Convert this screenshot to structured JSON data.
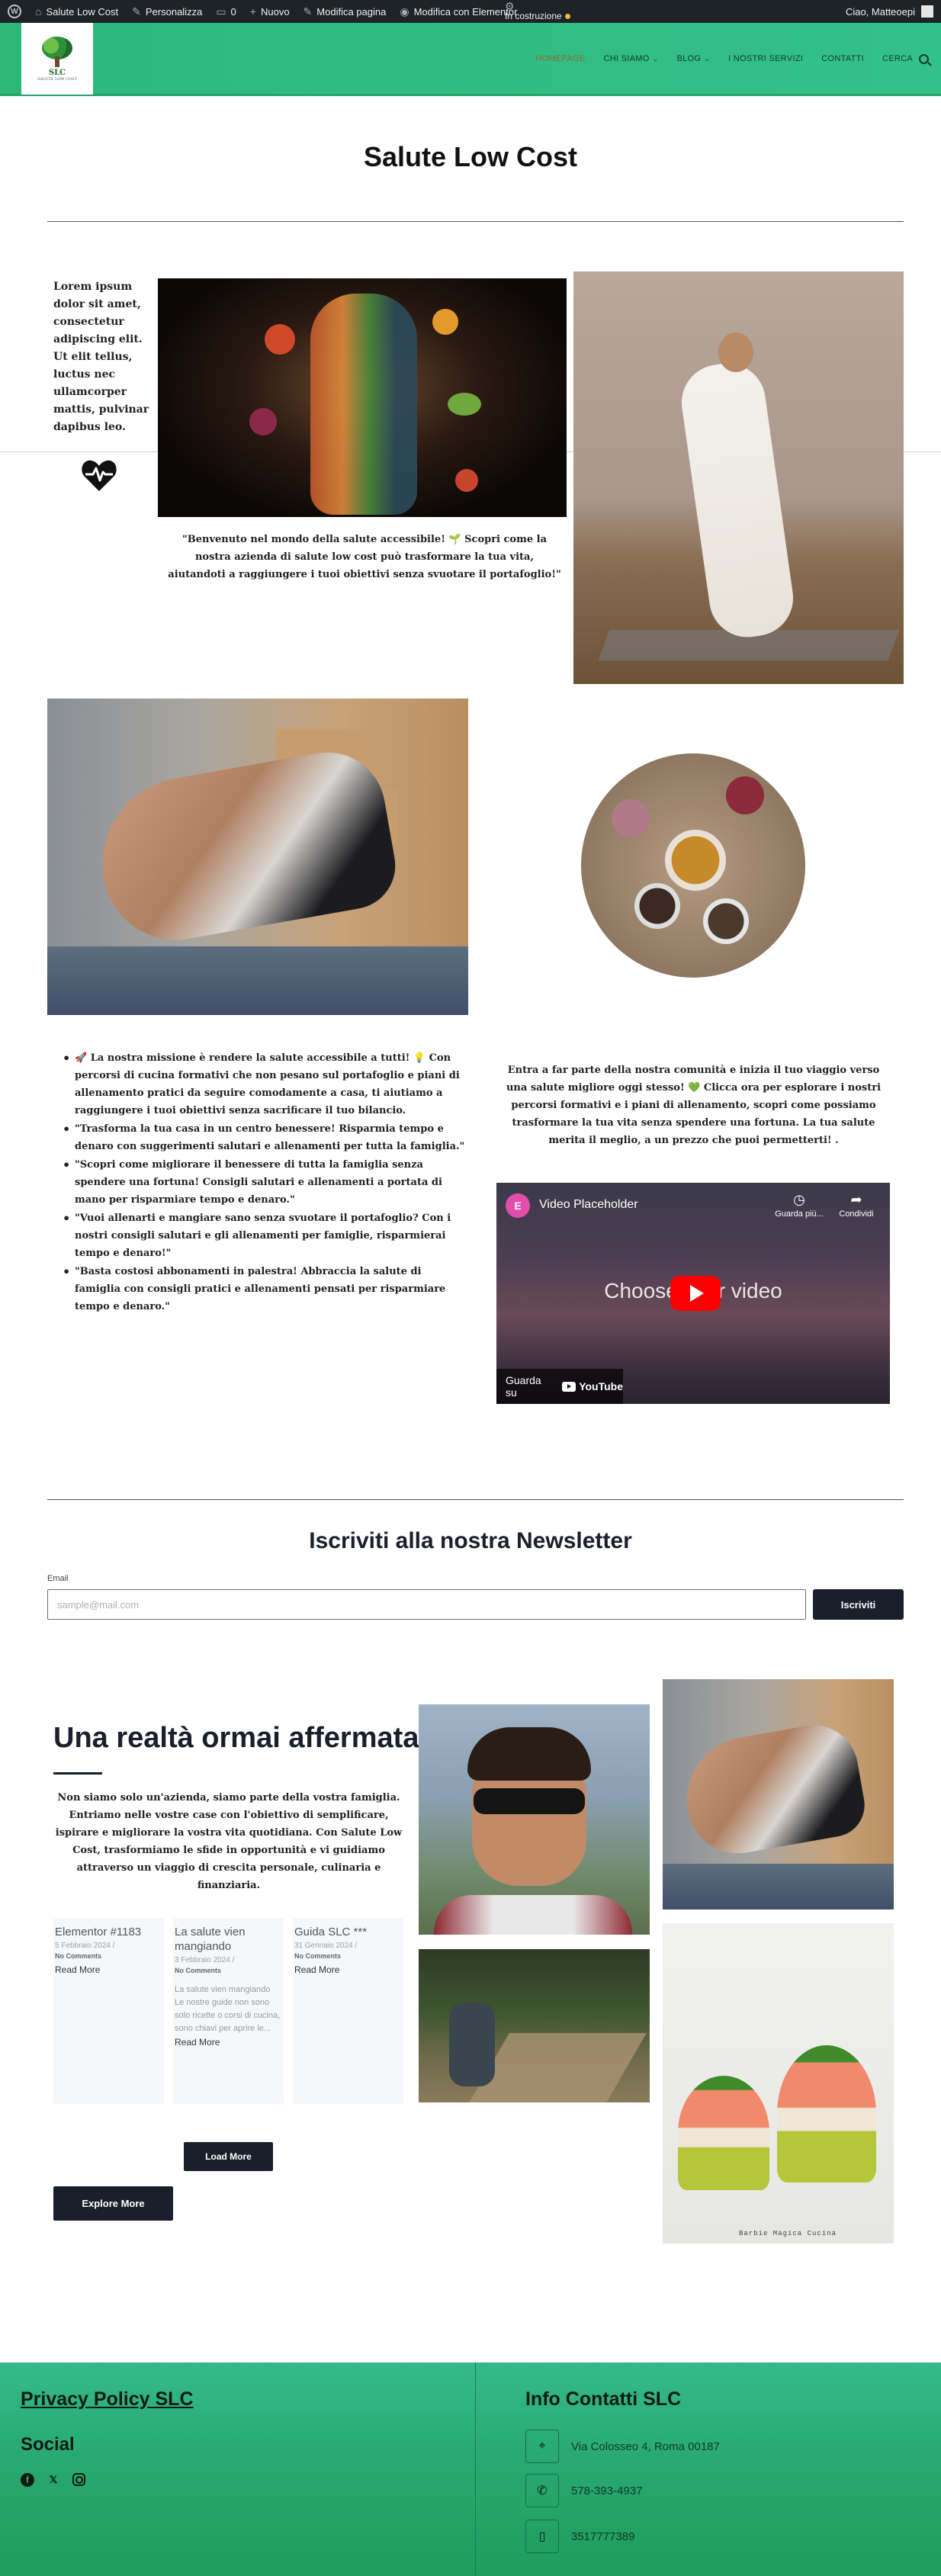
{
  "adminbar": {
    "site_name": "Salute Low Cost",
    "customize": "Personalizza",
    "comments_count": "0",
    "new": "Nuovo",
    "edit_page": "Modifica pagina",
    "edit_elementor": "Modifica con Elementor",
    "building": "In costruzione",
    "greeting": "Ciao, Matteoepi"
  },
  "header": {
    "logo_text": "SLC",
    "logo_sub": "SALUTE LOW COST",
    "nav": [
      {
        "label": "Homepage"
      },
      {
        "label": "Chi siamo"
      },
      {
        "label": "Blog"
      },
      {
        "label": "I nostri servizi"
      },
      {
        "label": "Contatti"
      },
      {
        "label": "Cerca"
      }
    ]
  },
  "page": {
    "title": "Salute Low Cost",
    "intro_text": "Lorem ipsum dolor sit amet, consectetur adipiscing elit. Ut elit tellus, luctus nec ullamcorper mattis, pulvinar dapibus leo.",
    "quote": "\"Benvenuto nel mondo della salute accessibile! 🌱 Scopri come la nostra azienda di salute low cost può trasformare la tua vita, aiutandoti a raggiungere i tuoi obiettivi senza svuotare il portafoglio!\"",
    "mission_list": [
      "🚀 La nostra missione è rendere la salute accessibile a tutti! 💡 Con percorsi di cucina formativi che non pesano sul portafoglio e piani di allenamento pratici da seguire comodamente a casa, ti aiutiamo a raggiungere i tuoi obiettivi senza sacrificare il tuo bilancio.",
      "\"Trasforma la tua casa in un centro benessere! Risparmia tempo e denaro con suggerimenti salutari e allenamenti per tutta la famiglia.\"",
      "\"Scopri come migliorare il benessere di tutta la famiglia senza spendere una fortuna! Consigli salutari e allenamenti a portata di mano per risparmiare tempo e denaro.\"",
      "\"Vuoi allenarti e mangiare sano senza svuotare il portafoglio? Con i nostri consigli salutari e gli allenamenti per famiglie, risparmierai tempo e denaro!\"",
      "\"Basta costosi abbonamenti in palestra! Abbraccia la salute di famiglia con consigli pratici e allenamenti pensati per risparmiare tempo e denaro.\""
    ],
    "join_text": "Entra a far parte della nostra comunità e inizia il tuo viaggio verso una salute migliore oggi stesso! 💚 Clicca ora per esplorare i nostri percorsi formativi e i piani di allenamento, scopri come possiamo trasformare la tua vita senza spendere una fortuna. La tua salute merita il meglio, a un prezzo che puoi permetterti! ."
  },
  "video": {
    "title": "Video Placeholder",
    "watch_later": "Guarda più...",
    "share": "Condividi",
    "center_text": "Choose your video",
    "watch_on": "Guarda su",
    "youtube": "YouTube"
  },
  "newsletter": {
    "title": "Iscriviti alla nostra Newsletter",
    "email_label": "Email",
    "email_placeholder": "sample@mail.com",
    "button": "Iscriviti"
  },
  "reality": {
    "title": "Una realtà ormai affermata",
    "text": "Non siamo solo un'azienda, siamo parte della vostra famiglia. Entriamo nelle vostre case con l'obiettivo di semplificare, ispirare e migliorare la vostra vita quotidiana. Con Salute Low Cost, trasformiamo le sfide in opportunità e vi guidiamo attraverso un viaggio di crescita personale, culinaria e finanziaria."
  },
  "posts": [
    {
      "title": "Elementor #1183",
      "date": "5 Febbraio 2024 /",
      "comments": "No Comments",
      "excerpt": "",
      "read_more": "Read More"
    },
    {
      "title": "La salute vien mangiando",
      "date": "3 Febbraio 2024 /",
      "comments": "No Comments",
      "excerpt": "La salute vien mangiando Le nostre guide non sono solo ricette o corsi di cucina, sono chiavi per aprire le...",
      "read_more": "Read More"
    },
    {
      "title": "Guida SLC ***",
      "date": "31 Gennaio 2024 /",
      "comments": "No Comments",
      "excerpt": "",
      "read_more": "Read More"
    }
  ],
  "buttons": {
    "load_more": "Load More",
    "explore_more": "Explore More"
  },
  "images": {
    "salmon_caption": "Barbie Magica Cucina"
  },
  "footer": {
    "privacy": "Privacy Policy SLC",
    "social_heading": "Social",
    "info_heading": "Info Contatti SLC",
    "address": "Via Colosseo 4, Roma 00187",
    "phone": "578-393-4937",
    "mobile": "3517777389"
  },
  "colors": {
    "brand_green": "#2db87a",
    "dark": "#1a1f2c",
    "admin_bar": "#1d2327"
  }
}
